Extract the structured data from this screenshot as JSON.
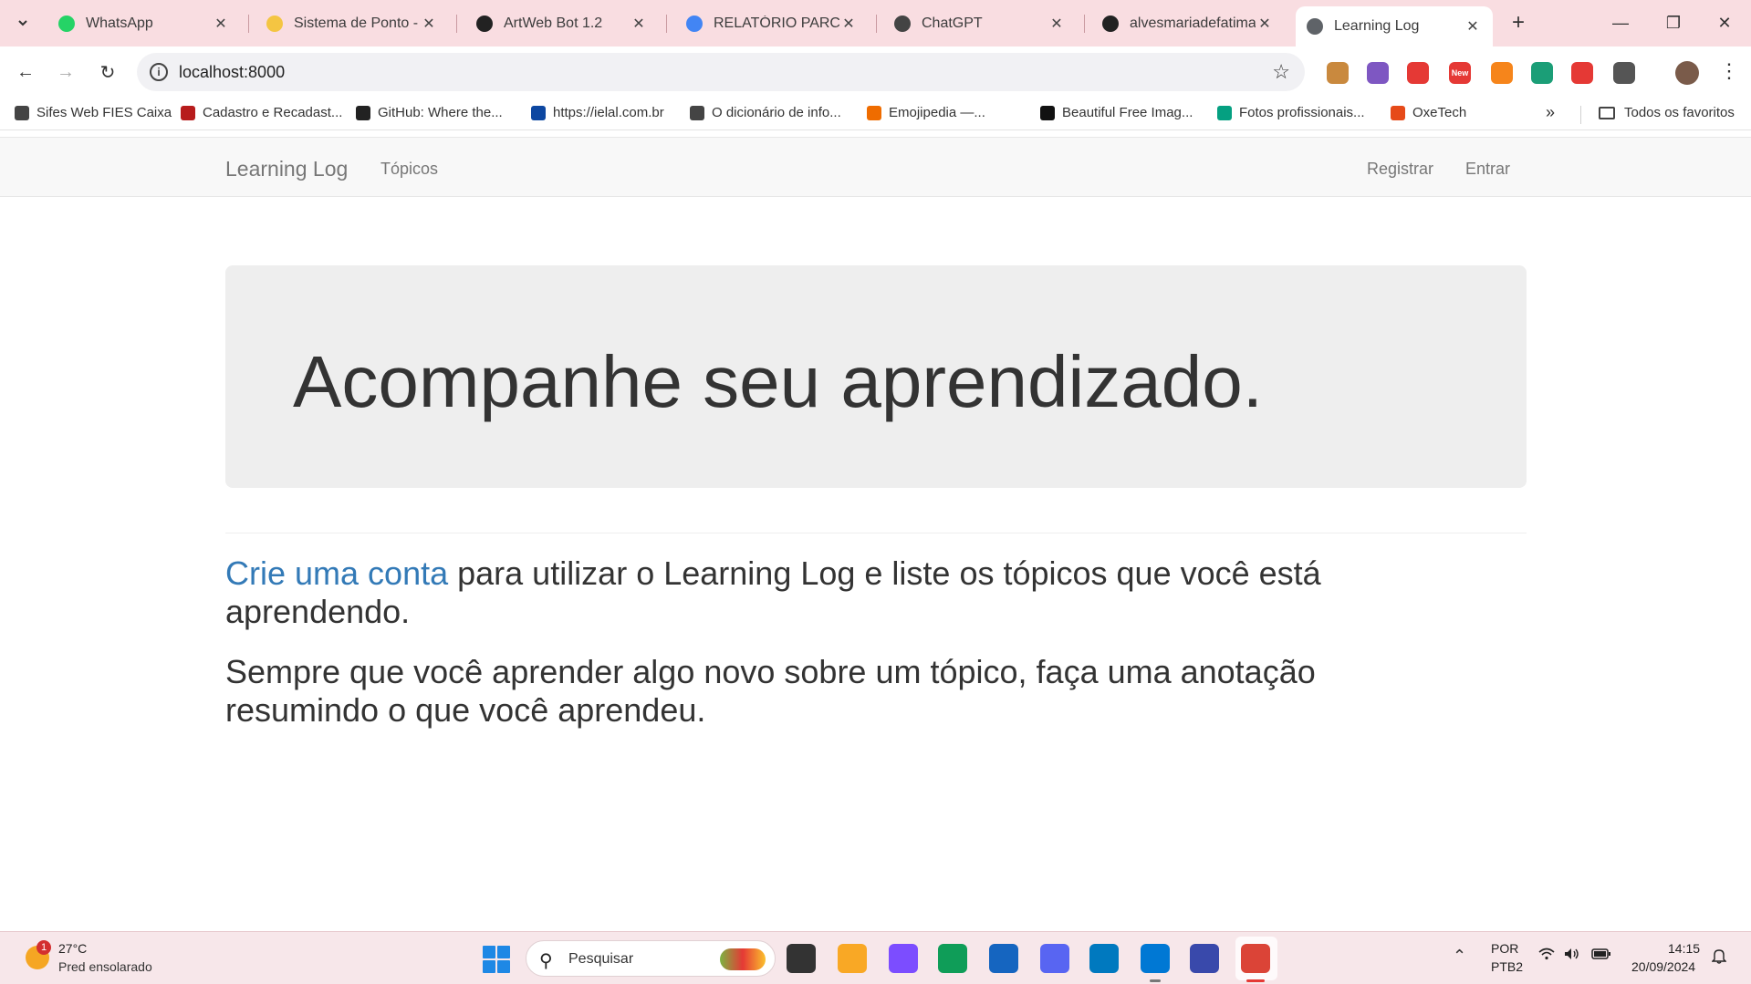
{
  "browser": {
    "tabs": [
      {
        "title": "WhatsApp",
        "icon": "whatsapp-icon",
        "color": "#25d366"
      },
      {
        "title": "Sistema de Ponto - A",
        "icon": "hand-icon",
        "color": "#f4c542"
      },
      {
        "title": "ArtWeb Bot 1.2",
        "icon": "artweb-icon",
        "color": "#222222"
      },
      {
        "title": "RELATÓRIO PARCIAL",
        "icon": "docs-icon",
        "color": "#4285f4"
      },
      {
        "title": "ChatGPT",
        "icon": "chatgpt-icon",
        "color": "#444444"
      },
      {
        "title": "alvesmariadefatima/l",
        "icon": "github-icon",
        "color": "#222222"
      },
      {
        "title": "Learning Log",
        "icon": "globe-icon",
        "color": "#5f6368"
      }
    ],
    "active_tab_index": 6,
    "url": "localhost:8000",
    "bookmarks": [
      {
        "label": "Sifes Web FIES Caixa",
        "icon": "globe-icon",
        "color": "#444444"
      },
      {
        "label": "Cadastro e Recadast...",
        "icon": "v-icon",
        "color": "#b71c1c"
      },
      {
        "label": "GitHub: Where the...",
        "icon": "github-icon",
        "color": "#222222"
      },
      {
        "label": "https://ielal.com.br",
        "icon": "ielal-icon",
        "color": "#0d47a1"
      },
      {
        "label": "O dicionário de info...",
        "icon": "globe-icon",
        "color": "#444444"
      },
      {
        "label": "Emojipedia —...",
        "icon": "emojipedia-icon",
        "color": "#ef6c00"
      },
      {
        "label": "Beautiful Free Imag...",
        "icon": "unsplash-icon",
        "color": "#111111"
      },
      {
        "label": "Fotos profissionais...",
        "icon": "pexels-icon",
        "color": "#05a081"
      },
      {
        "label": "OxeTech",
        "icon": "oxetech-icon",
        "color": "#e64a19"
      }
    ],
    "all_bookmarks_label": "Todos os favoritos",
    "extensions": [
      {
        "icon": "cookie-icon",
        "color": "#c9893e"
      },
      {
        "icon": "puzzle-purple-icon",
        "color": "#7e57c2"
      },
      {
        "icon": "shield-icon",
        "color": "#e53935"
      },
      {
        "icon": "new-badge-icon",
        "color": "#e53935",
        "badge": "New"
      },
      {
        "icon": "metamask-icon",
        "color": "#f6851b"
      },
      {
        "icon": "bird-icon",
        "color": "#1b9e77"
      },
      {
        "icon": "opera-icon",
        "color": "#e53935"
      },
      {
        "icon": "extensions-icon",
        "color": "#555555"
      }
    ]
  },
  "site": {
    "brand": "Learning Log",
    "nav_left": [
      "Tópicos"
    ],
    "nav_right": [
      "Registrar",
      "Entrar"
    ],
    "jumbotron_heading": "Acompanhe seu aprendizado.",
    "paragraph1_link": "Crie uma conta",
    "paragraph1_rest": " para utilizar o Learning Log e liste os tópicos que você está aprendendo.",
    "paragraph2": "Sempre que você aprender algo novo sobre um tópico, faça uma anotação resumindo o que você aprendeu.",
    "link_color": "#337ab7"
  },
  "taskbar": {
    "weather_temp": "27°C",
    "weather_desc": "Pred ensolarado",
    "weather_badge": "1",
    "search_placeholder": "Pesquisar",
    "apps": [
      {
        "name": "task-view-icon",
        "color": "#333333"
      },
      {
        "name": "file-explorer-icon",
        "color": "#f9a825"
      },
      {
        "name": "copilot-icon",
        "color": "#7c4dff"
      },
      {
        "name": "edge-icon",
        "color": "#0f9d58"
      },
      {
        "name": "ms-store-icon",
        "color": "#1565c0"
      },
      {
        "name": "discord-icon",
        "color": "#5865f2"
      },
      {
        "name": "trello-icon",
        "color": "#0079bf"
      },
      {
        "name": "vscode-icon",
        "color": "#0078d4"
      },
      {
        "name": "app-blue-icon",
        "color": "#3949ab"
      },
      {
        "name": "chrome-icon",
        "color": "#db4437"
      }
    ],
    "lang_line1": "POR",
    "lang_line2": "PTB2",
    "time": "14:15",
    "date": "20/09/2024"
  }
}
